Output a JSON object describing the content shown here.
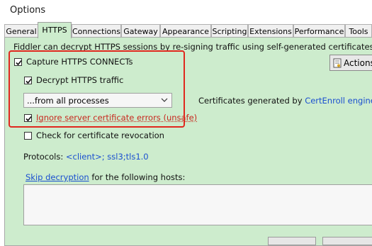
{
  "window": {
    "title": "Options"
  },
  "tabs": [
    {
      "label": "General"
    },
    {
      "label": "HTTPS"
    },
    {
      "label": "Connections"
    },
    {
      "label": "Gateway"
    },
    {
      "label": "Appearance"
    },
    {
      "label": "Scripting"
    },
    {
      "label": "Extensions"
    },
    {
      "label": "Performance"
    },
    {
      "label": "Tools"
    }
  ],
  "active_tab": "HTTPS",
  "https": {
    "description": "Fiddler can decrypt HTTPS sessions by re-signing traffic using self-generated certificates.",
    "capture_label": "Capture HTTPS CONNECTs",
    "capture_checked": true,
    "decrypt_label": "Decrypt HTTPS traffic",
    "decrypt_checked": true,
    "process_filter": "...from all processes",
    "ignore_errors_label": "Ignore server certificate errors (unsafe)",
    "ignore_errors_checked": true,
    "revocation_label": "Check for certificate revocation",
    "revocation_checked": false,
    "cert_generated_prefix": "Certificates generated by ",
    "cert_engine_link": "CertEnroll engine",
    "actions_label": "Actions",
    "protocols_label": "Protocols: ",
    "protocols_value": "<client>; ssl3;tls1.0",
    "skip_link": "Skip decryption",
    "skip_suffix": " for the following hosts:",
    "hosts_text": ""
  },
  "colors": {
    "panel_bg": "#cdeccd",
    "highlight_border": "#e0281e",
    "warning_text": "#c8281e",
    "link": "#1a4fd0"
  }
}
